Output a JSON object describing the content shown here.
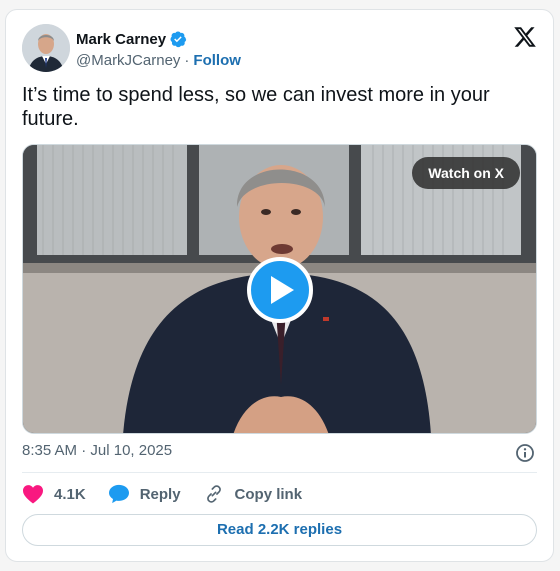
{
  "author": {
    "display_name": "Mark Carney",
    "handle": "@MarkJCarney",
    "separator": "·",
    "follow_label": "Follow"
  },
  "tweet": {
    "text": "It’s time to spend less, so we can invest more in your future."
  },
  "media": {
    "watch_label": "Watch on X"
  },
  "meta": {
    "time": "8:35 AM",
    "separator": "·",
    "date": "Jul 10, 2025"
  },
  "actions": {
    "likes_count": "4.1K",
    "reply_label": "Reply",
    "copy_link_label": "Copy link"
  },
  "replies_button": {
    "label": "Read 2.2K replies"
  },
  "colors": {
    "accent": "#1d9bf0",
    "link": "#1d6fb0",
    "heart": "#f91880",
    "text_secondary": "#536471"
  },
  "icons": [
    "verified-badge-icon",
    "x-logo-icon",
    "play-icon",
    "info-icon",
    "heart-icon",
    "reply-bubble-icon",
    "link-icon"
  ]
}
